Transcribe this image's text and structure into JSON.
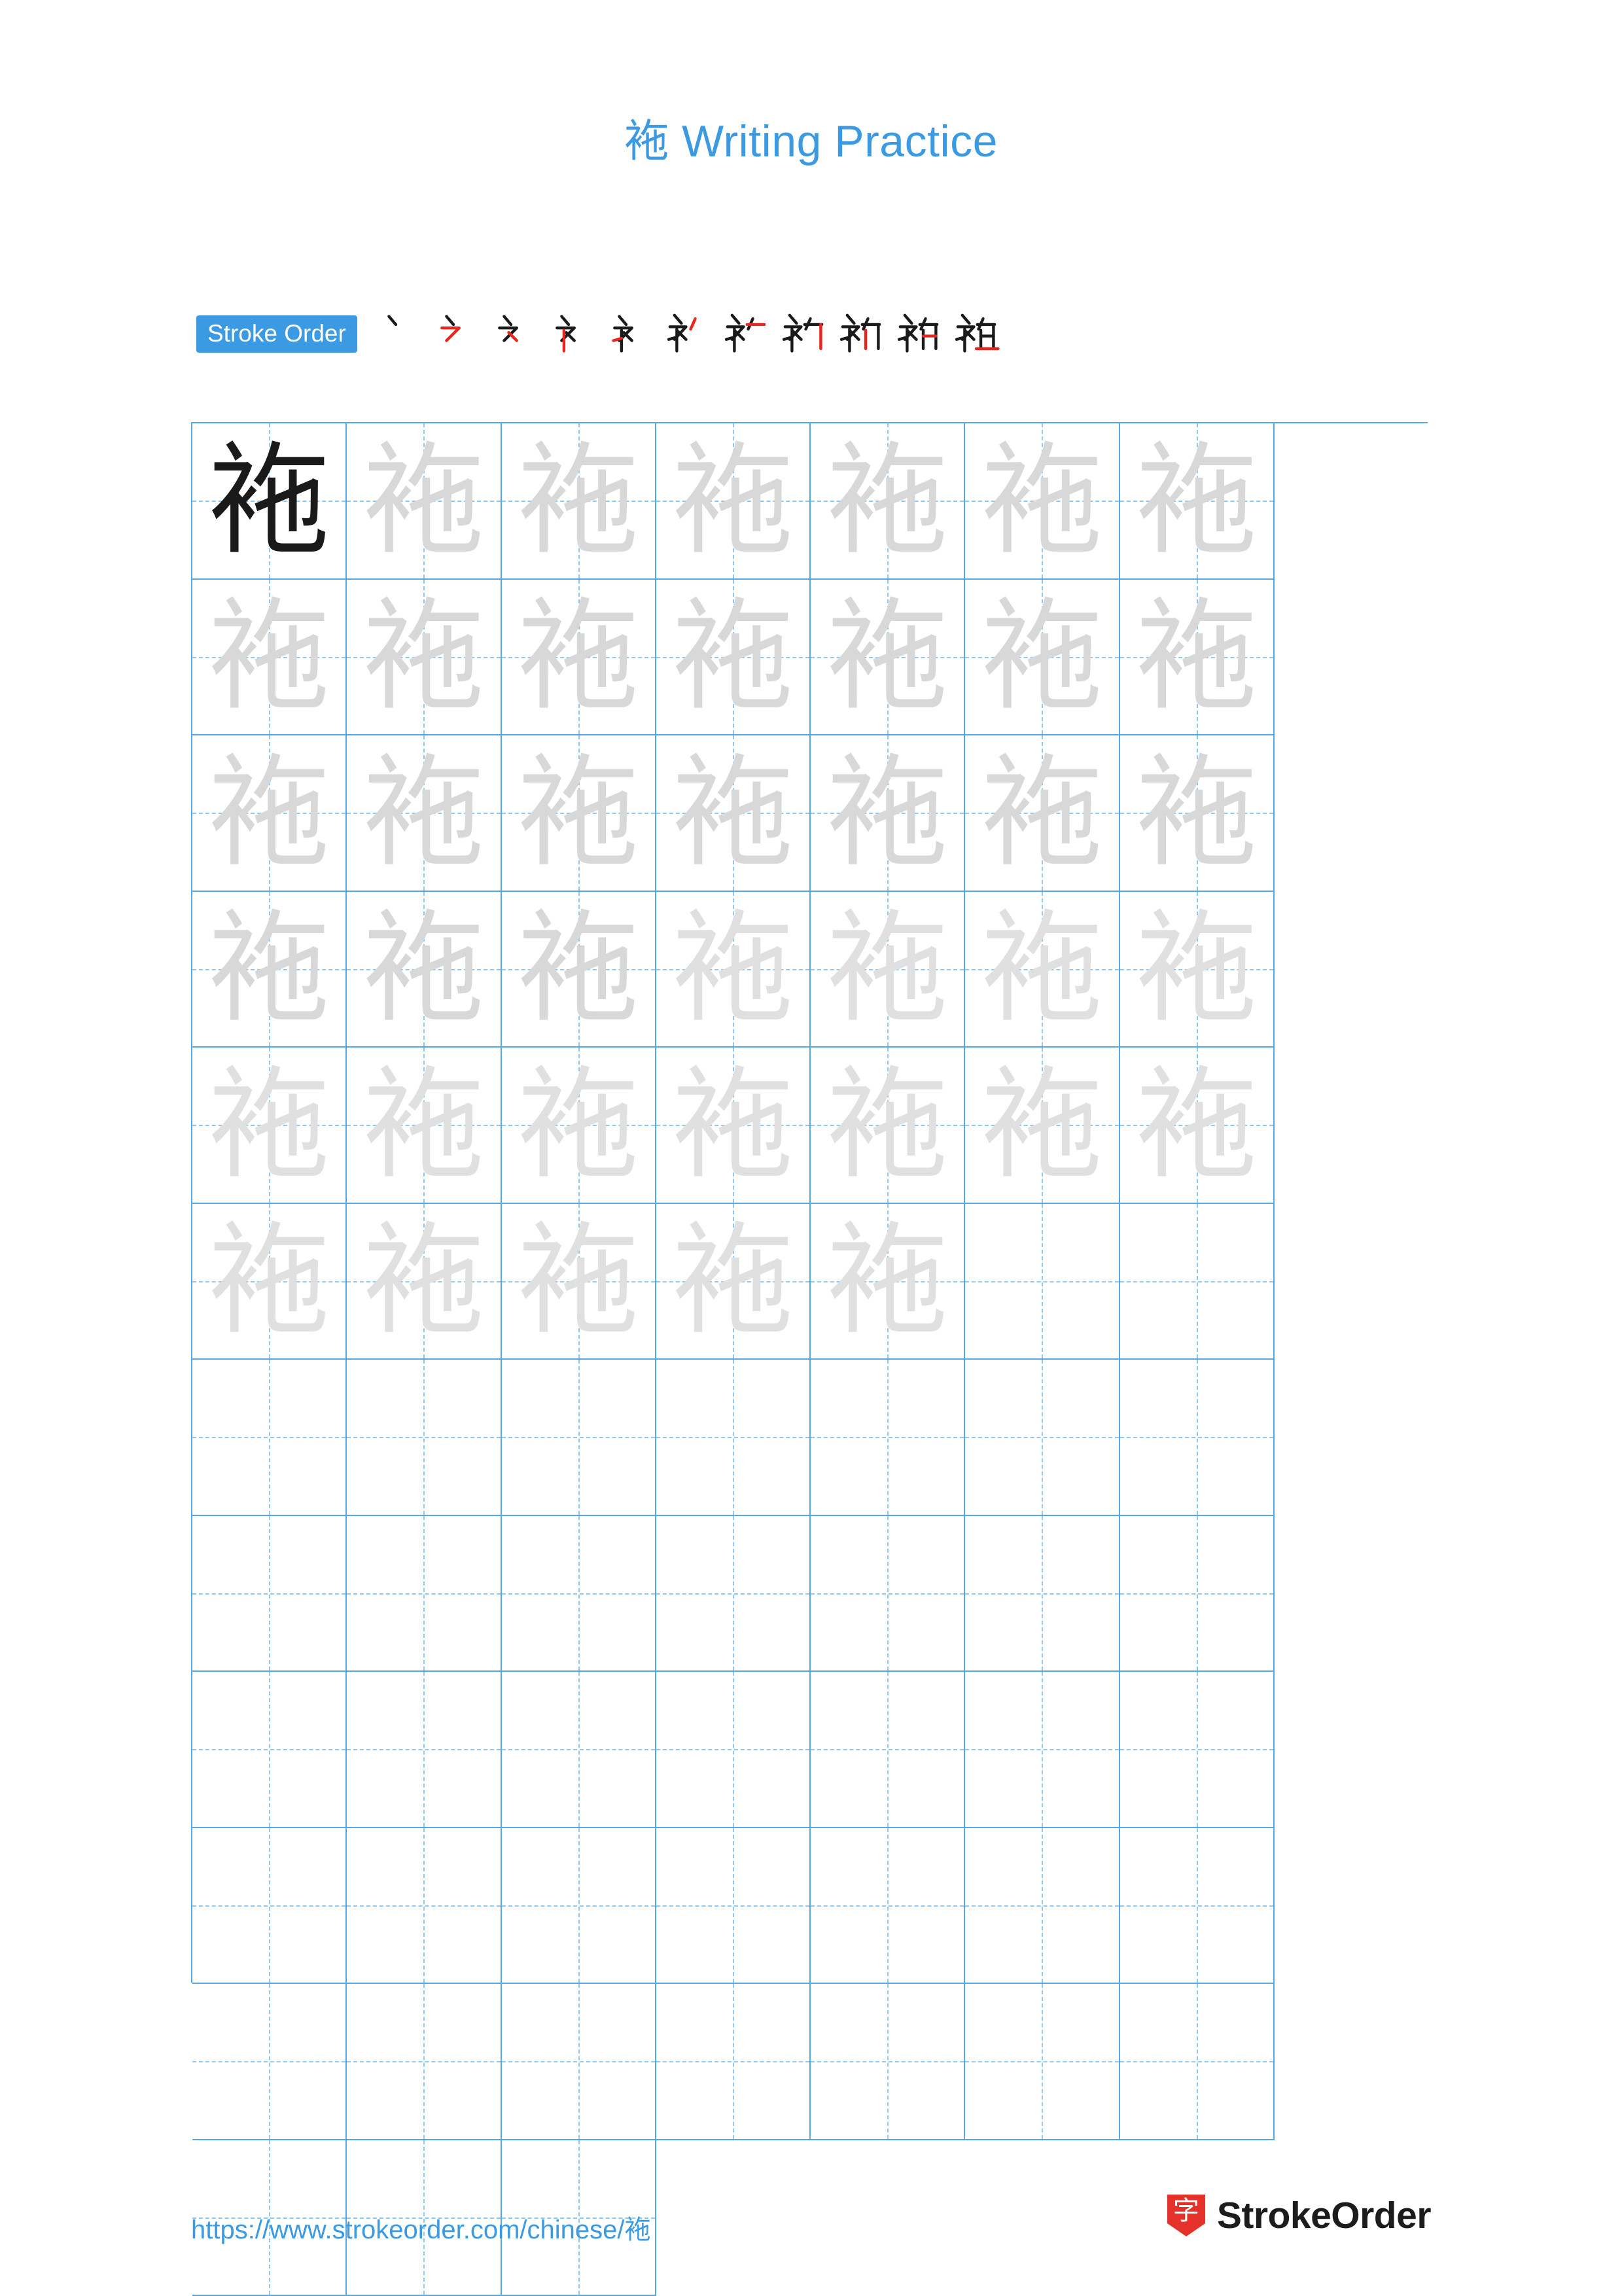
{
  "page": {
    "character": "袘",
    "title_suffix": " Writing Practice"
  },
  "stroke_order": {
    "label": "Stroke Order",
    "count": 11,
    "strokes": [
      "丶",
      "㇒",
      "㇒丶",
      "礻",
      "礻",
      "袸",
      "袸",
      "袸",
      "袸",
      "袸",
      "袈"
    ]
  },
  "grid": {
    "columns": 8,
    "rows": 10,
    "filled_rows": 5,
    "model_cell_index": 0,
    "character": "袘"
  },
  "footer": {
    "url_prefix": "https://www.strokeorder.com/chinese/",
    "url_character": "袘",
    "brand_name": "StrokeOrder",
    "brand_logo_char": "字",
    "brand_logo_color": "#e4322b"
  },
  "colors": {
    "accent": "#3b9ae1",
    "grid_line": "#57a8e8",
    "grid_dash": "#8fc8f0",
    "stroke_new": "#e8261f",
    "stroke_old": "#1a1a1a",
    "ghost": "#cfcfcf"
  }
}
